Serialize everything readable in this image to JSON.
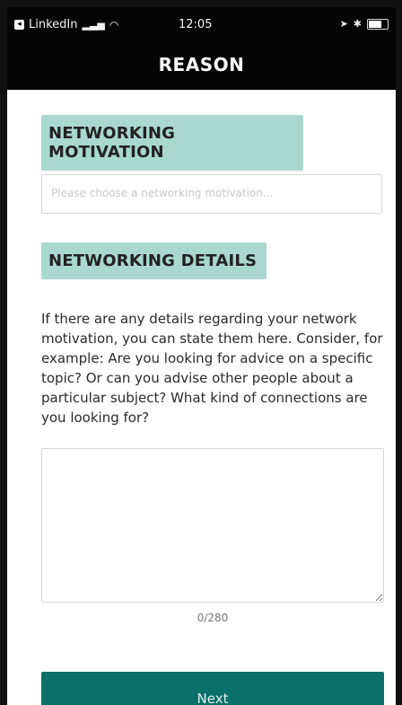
{
  "status_bar": {
    "app_back": "LinkedIn",
    "time": "12:05"
  },
  "header": {
    "title": "REASON"
  },
  "sections": {
    "motivation_title": "NETWORKING MOTIVATION",
    "motivation_placeholder": "Please choose a networking motivation...",
    "details_title": "NETWORKING DETAILS",
    "details_description": "If there are any details regarding your network motivation, you can state them here. Consider, for example: Are you looking for advice on a specific topic? Or can you advise other people about a particular subject? What kind of connections are you looking for?"
  },
  "textarea": {
    "value": "",
    "counter": "0/280"
  },
  "actions": {
    "next_label": "Next"
  },
  "colors": {
    "pill": "#a8d8ce",
    "button": "#0b6f6a",
    "header_bg": "#050505"
  }
}
